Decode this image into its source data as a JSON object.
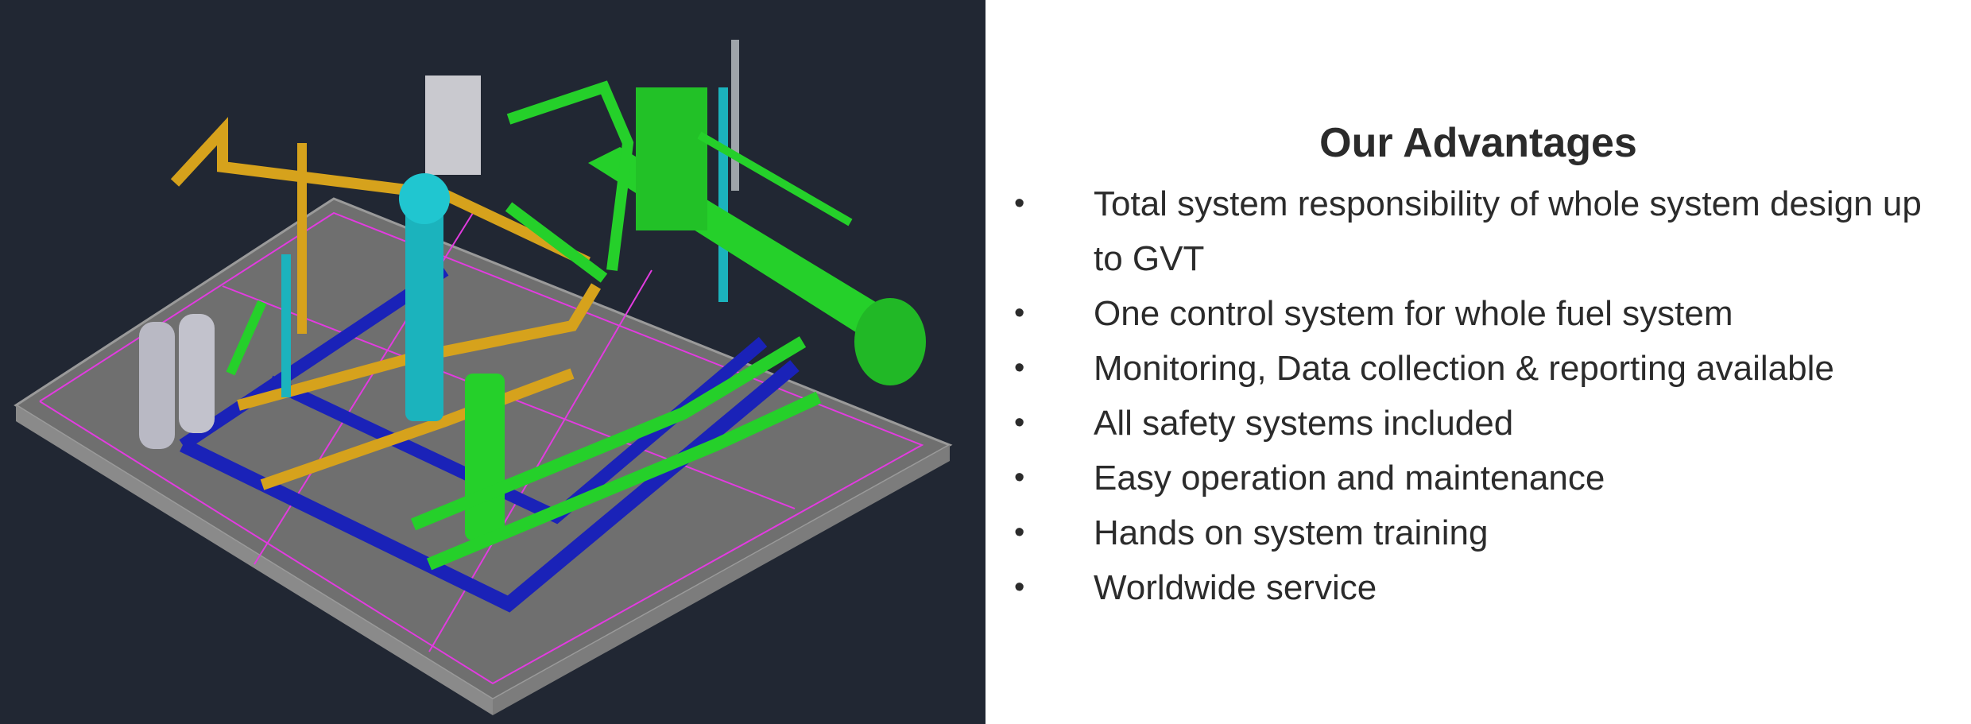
{
  "render": {
    "background_color": "#212733",
    "colors": {
      "green_pipe": "#25d02a",
      "yellow_pipe": "#d6a21c",
      "blue_channel": "#1a22b8",
      "cyan_pipe": "#1bb3bd",
      "gray_frame": "#8c8c8c",
      "magenta_line": "#e23be0"
    }
  },
  "advantages": {
    "title": "Our Advantages",
    "bullet_glyph": "•",
    "items": [
      "Total system responsibility of whole system design up to GVT",
      "One control system for whole fuel system",
      "Monitoring, Data collection & reporting available",
      "All safety systems included",
      "Easy operation and maintenance",
      "Hands on system training",
      "Worldwide service"
    ]
  }
}
